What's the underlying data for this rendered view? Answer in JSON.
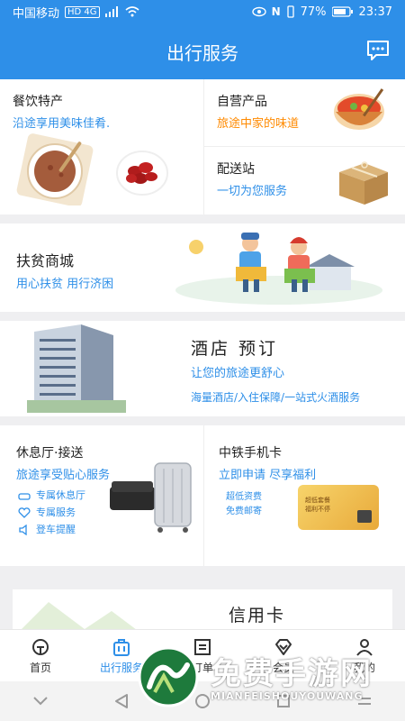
{
  "status_bar": {
    "carrier": "中国移动",
    "network": "HD 4G",
    "battery_pct": "77%",
    "time": "23:37"
  },
  "header": {
    "title": "出行服务"
  },
  "food": {
    "main_title": "餐饮特产",
    "main_sub": "沿途享用美味佳肴.",
    "self_title": "自营产品",
    "self_sub": "旅途中家的味道",
    "delivery_title": "配送站",
    "delivery_sub": "一切为您服务"
  },
  "poverty": {
    "title": "扶贫商城",
    "sub": "用心扶贫 用行济困"
  },
  "hotel": {
    "title": "酒店 预订",
    "sub": "让您的旅途更舒心",
    "desc": "海量酒店/入住保障/一站式火酒服务"
  },
  "lounge": {
    "title": "休息厅·接送",
    "sub": "旅途享受贴心服务",
    "items": [
      "专属休息厅",
      "专属服务",
      "登车提醒"
    ]
  },
  "phone_card": {
    "title": "中铁手机卡",
    "sub": "立即申请  尽享福利",
    "tags": [
      "超低资费",
      "免费邮寄"
    ],
    "card_lines": [
      "超低套餐",
      "福利不停"
    ]
  },
  "credit": {
    "title": "信用卡"
  },
  "nav": [
    {
      "label": "首页",
      "icon": "home-icon"
    },
    {
      "label": "出行服务",
      "icon": "luggage-icon"
    },
    {
      "label": "订单",
      "icon": "order-icon"
    },
    {
      "label": "会员",
      "icon": "member-icon"
    },
    {
      "label": "我的",
      "icon": "user-icon"
    }
  ],
  "watermark": {
    "text": "免费手游网",
    "sub": "MIANFEISHOUYOUWANG"
  },
  "colors": {
    "primary": "#2e8fe8",
    "orange": "#ff8a00"
  }
}
